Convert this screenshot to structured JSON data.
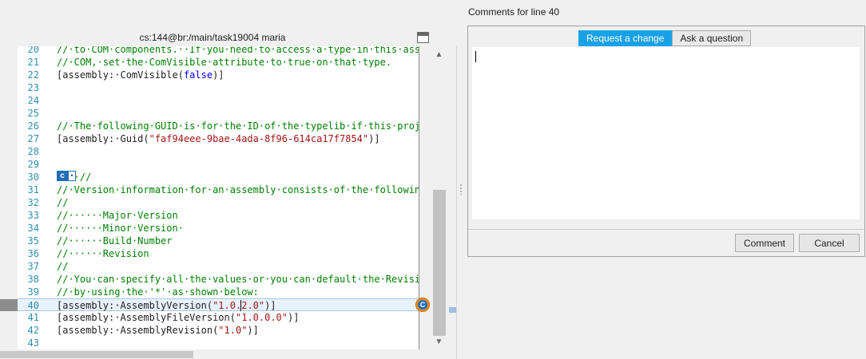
{
  "left": {
    "title": "cs:144@br:/main/task19004 maria",
    "lines": [
      {
        "n": "20",
        "parts": [
          {
            "t": "c-comment",
            "s": "//·to·COM·components.··If·you·need·to·access·a·type·in·this·assem"
          }
        ]
      },
      {
        "n": "21",
        "parts": [
          {
            "t": "c-comment",
            "s": "//·COM,·set·the·ComVisible·attribute·to·true·on·that·type."
          }
        ]
      },
      {
        "n": "22",
        "parts": [
          {
            "t": "c-normal",
            "s": "[assembly:·ComVisible("
          },
          {
            "t": "c-keyword",
            "s": "false"
          },
          {
            "t": "c-normal",
            "s": ")]"
          }
        ]
      },
      {
        "n": "23",
        "parts": []
      },
      {
        "n": "24",
        "parts": []
      },
      {
        "n": "25",
        "parts": []
      },
      {
        "n": "26",
        "parts": [
          {
            "t": "c-comment",
            "s": "//·The·following·GUID·is·for·the·ID·of·the·typelib·if·this·proje"
          }
        ]
      },
      {
        "n": "27",
        "parts": [
          {
            "t": "c-normal",
            "s": "[assembly:·Guid("
          },
          {
            "t": "c-string",
            "s": "\"faf94eee-9bae-4ada-8f96-614ca17f7854\""
          },
          {
            "t": "c-normal",
            "s": ")]"
          }
        ]
      },
      {
        "n": "28",
        "parts": []
      },
      {
        "n": "29",
        "parts": []
      },
      {
        "n": "30",
        "parts": [
          {
            "t": "c-comment",
            "s": "····//"
          }
        ],
        "badge": true
      },
      {
        "n": "31",
        "parts": [
          {
            "t": "c-comment",
            "s": "//·Version·information·for·an·assembly·consists·of·the·following"
          }
        ]
      },
      {
        "n": "32",
        "parts": [
          {
            "t": "c-comment",
            "s": "//"
          }
        ]
      },
      {
        "n": "33",
        "parts": [
          {
            "t": "c-comment",
            "s": "//······Major·Version"
          }
        ]
      },
      {
        "n": "34",
        "parts": [
          {
            "t": "c-comment",
            "s": "//······Minor·Version·"
          }
        ]
      },
      {
        "n": "35",
        "parts": [
          {
            "t": "c-comment",
            "s": "//······Build·Number"
          }
        ]
      },
      {
        "n": "36",
        "parts": [
          {
            "t": "c-comment",
            "s": "//······Revision"
          }
        ]
      },
      {
        "n": "37",
        "parts": [
          {
            "t": "c-comment",
            "s": "//"
          }
        ]
      },
      {
        "n": "38",
        "parts": [
          {
            "t": "c-comment",
            "s": "//·You·can·specify·all·the·values·or·you·can·default·the·Revisio"
          }
        ]
      },
      {
        "n": "39",
        "parts": [
          {
            "t": "c-comment",
            "s": "//·by·using·the·'*'·as·shown·below:"
          }
        ]
      },
      {
        "n": "40",
        "parts": [
          {
            "t": "c-normal",
            "s": "[assembly:·AssemblyVersion("
          },
          {
            "t": "c-string",
            "s": "\"1.0."
          },
          {
            "t": "c-string c-caret",
            "s": "2"
          },
          {
            "t": "c-string",
            "s": ".0\""
          },
          {
            "t": "c-normal",
            "s": ")]"
          }
        ],
        "current": true
      },
      {
        "n": "41",
        "parts": [
          {
            "t": "c-normal",
            "s": "[assembly:·AssemblyFileVersion("
          },
          {
            "t": "c-string",
            "s": "\"1.0.0.0\""
          },
          {
            "t": "c-normal",
            "s": ")]"
          }
        ]
      },
      {
        "n": "42",
        "parts": [
          {
            "t": "c-normal",
            "s": "[assembly:·AssemblyRevision("
          },
          {
            "t": "c-string",
            "s": "\"1.0\""
          },
          {
            "t": "c-normal",
            "s": ")]"
          }
        ]
      },
      {
        "n": "43",
        "parts": []
      }
    ],
    "badge_letter": "c",
    "badge_drop": "▾",
    "marker_letter": "C",
    "scroll_up": "▲",
    "scroll_down": "▼"
  },
  "right": {
    "title": "Comments for line 40",
    "tabs": [
      {
        "label": "Request a change",
        "active": true
      },
      {
        "label": "Ask a question",
        "active": false
      }
    ],
    "comment_value": "",
    "comment_button": "Comment",
    "cancel_button": "Cancel"
  },
  "colors": {
    "accent": "#19a1e7",
    "comment": "#008000",
    "string": "#a31515",
    "keyword": "#0000ff",
    "line_number": "#2b91af",
    "marker_orange": "#f28c13"
  }
}
